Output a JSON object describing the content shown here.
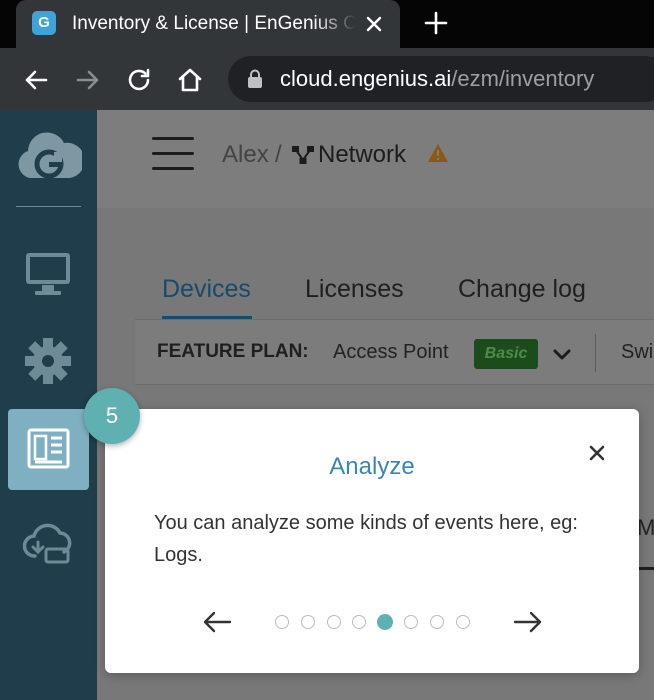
{
  "browser": {
    "tab_title": "Inventory & License | EnGenius Cloud",
    "favicon_letter": "G",
    "url_host": "cloud.engenius.ai",
    "url_path": "/ezm/inventory"
  },
  "sidebar": {
    "items": [
      {
        "icon": "monitor-icon"
      },
      {
        "icon": "gear-icon"
      },
      {
        "icon": "inventory-icon",
        "active": true
      },
      {
        "icon": "cloud-sync-icon"
      }
    ]
  },
  "header": {
    "breadcrumb_user": "Alex",
    "breadcrumb_sep": "/",
    "breadcrumb_network": "Network"
  },
  "tabs": [
    {
      "label": "Devices",
      "active": true
    },
    {
      "label": "Licenses"
    },
    {
      "label": "Change log"
    }
  ],
  "feature_plan": {
    "label": "FEATURE PLAN:",
    "product": "Access Point",
    "badge": "Basic",
    "next_product": "Swi"
  },
  "background_partial_text": "M",
  "tour": {
    "step": "5",
    "title": "Analyze",
    "body": "You can analyze some kinds of events here, eg: Logs.",
    "total_steps": 8,
    "current_step_index": 4
  },
  "colors": {
    "accent": "#3a86b1",
    "step_badge": "#5eb1b0",
    "sidebar": "#1f3d4a",
    "basic_badge": "#1d4c1c"
  }
}
